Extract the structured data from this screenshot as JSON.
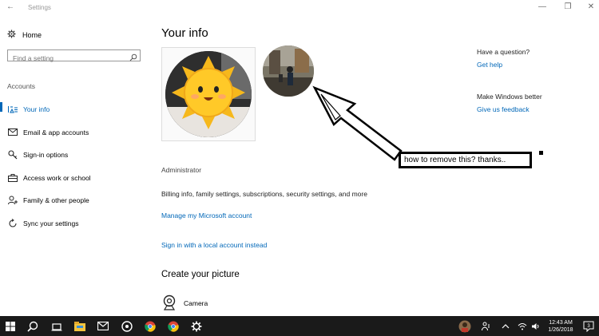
{
  "window": {
    "title": "Settings"
  },
  "sidebar": {
    "home_label": "Home",
    "search_placeholder": "Find a setting",
    "section_label": "Accounts",
    "items": [
      {
        "label": "Your info",
        "icon": "person-list-icon",
        "active": true
      },
      {
        "label": "Email & app accounts",
        "icon": "mail-icon",
        "active": false
      },
      {
        "label": "Sign-in options",
        "icon": "key-icon",
        "active": false
      },
      {
        "label": "Access work or school",
        "icon": "briefcase-icon",
        "active": false
      },
      {
        "label": "Family & other people",
        "icon": "people-add-icon",
        "active": false
      },
      {
        "label": "Sync your settings",
        "icon": "sync-icon",
        "active": false
      }
    ]
  },
  "main": {
    "title": "Your info",
    "role": "Administrator",
    "billing_text": "Billing info, family settings, subscriptions, security settings, and more",
    "manage_link": "Manage my Microsoft account",
    "local_link": "Sign in with a local account instead",
    "create_title": "Create your picture",
    "camera_label": "Camera"
  },
  "right": {
    "question": "Have a question?",
    "help_link": "Get help",
    "better": "Make Windows better",
    "feedback_link": "Give us feedback"
  },
  "annotation": {
    "text": "how to remove this? thanks.."
  },
  "taskbar": {
    "time": "12:43 AM",
    "date": "1/26/2018"
  },
  "colors": {
    "accent": "#0067b8",
    "taskbar": "#1a1a1a",
    "sun": "#ffc928"
  }
}
